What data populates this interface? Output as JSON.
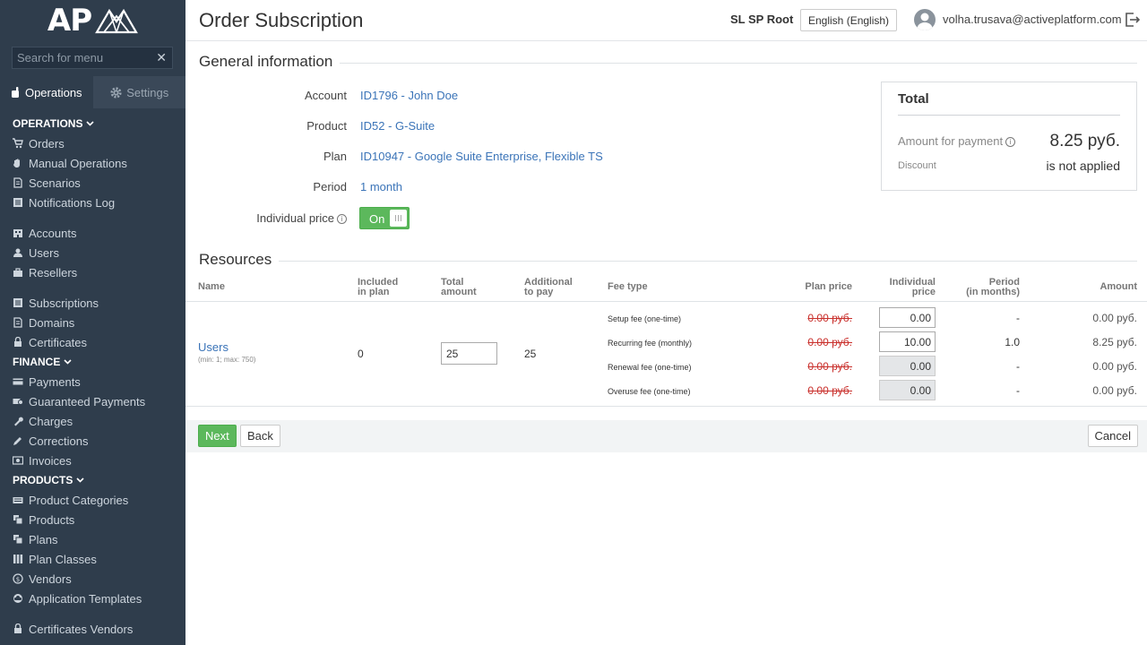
{
  "sidebar": {
    "logo_text": "AP",
    "search_placeholder": "Search for menu",
    "tabs": [
      {
        "label": "Operations"
      },
      {
        "label": "Settings"
      }
    ],
    "sections": {
      "operations": "OPERATIONS",
      "finance": "FINANCE",
      "products": "PRODUCTS"
    },
    "items": {
      "orders": "Orders",
      "manual_operations": "Manual Operations",
      "scenarios": "Scenarios",
      "notifications_log": "Notifications Log",
      "accounts": "Accounts",
      "users": "Users",
      "resellers": "Resellers",
      "subscriptions": "Subscriptions",
      "domains": "Domains",
      "certificates": "Certificates",
      "payments": "Payments",
      "guaranteed_payments": "Guaranteed Payments",
      "charges": "Charges",
      "corrections": "Corrections",
      "invoices": "Invoices",
      "product_categories": "Product Categories",
      "products": "Products",
      "plans": "Plans",
      "plan_classes": "Plan Classes",
      "vendors": "Vendors",
      "application_templates": "Application Templates",
      "certificates_vendors": "Certificates Vendors"
    }
  },
  "header": {
    "title": "Order Subscription",
    "root": "SL SP Root",
    "language": "English (English)",
    "user_email": "volha.trusava@activeplatform.com"
  },
  "general": {
    "title": "General information",
    "account_label": "Account",
    "account_value": "ID1796 - John Doe",
    "product_label": "Product",
    "product_value": "ID52 - G-Suite",
    "plan_label": "Plan",
    "plan_value": "ID10947 - Google Suite Enterprise, Flexible TS",
    "period_label": "Period",
    "period_value": "1 month",
    "individual_price_label": "Individual price",
    "toggle_label": "On"
  },
  "total": {
    "title": "Total",
    "amount_label": "Amount for payment",
    "amount_value": "8.25 руб.",
    "discount_label": "Discount",
    "discount_value": "is not applied"
  },
  "resources": {
    "title": "Resources",
    "headers": {
      "name": "Name",
      "included_1": "Included",
      "included_2": "in plan",
      "total_1": "Total",
      "total_2": "amount",
      "additional_1": "Additional",
      "additional_2": "to pay",
      "fee_type": "Fee type",
      "plan_price": "Plan price",
      "individual_1": "Individual",
      "individual_2": "price",
      "period_1": "Period",
      "period_2": "(in months)",
      "amount": "Amount"
    },
    "row": {
      "name": "Users",
      "sub": "(min: 1; max: 750)",
      "included": "0",
      "total": "25",
      "additional": "25"
    },
    "fees": [
      {
        "type": "Setup fee (one-time)",
        "plan_price": "0.00 руб.",
        "individual": "0.00",
        "period": "-",
        "amount": "0.00 руб."
      },
      {
        "type": "Recurring fee (monthly)",
        "plan_price": "0.00 руб.",
        "individual": "10.00",
        "period": "1.0",
        "amount": "8.25 руб."
      },
      {
        "type": "Renewal fee (one-time)",
        "plan_price": "0.00 руб.",
        "individual": "0.00",
        "period": "-",
        "amount": "0.00 руб."
      },
      {
        "type": "Overuse fee (one-time)",
        "plan_price": "0.00 руб.",
        "individual": "0.00",
        "period": "-",
        "amount": "0.00 руб."
      }
    ]
  },
  "actions": {
    "next": "Next",
    "back": "Back",
    "cancel": "Cancel"
  },
  "colors": {
    "sidebar_bg": "#2f3d4c",
    "link": "#3b74b8",
    "success": "#5cb85c",
    "strike": "#c9302c"
  }
}
